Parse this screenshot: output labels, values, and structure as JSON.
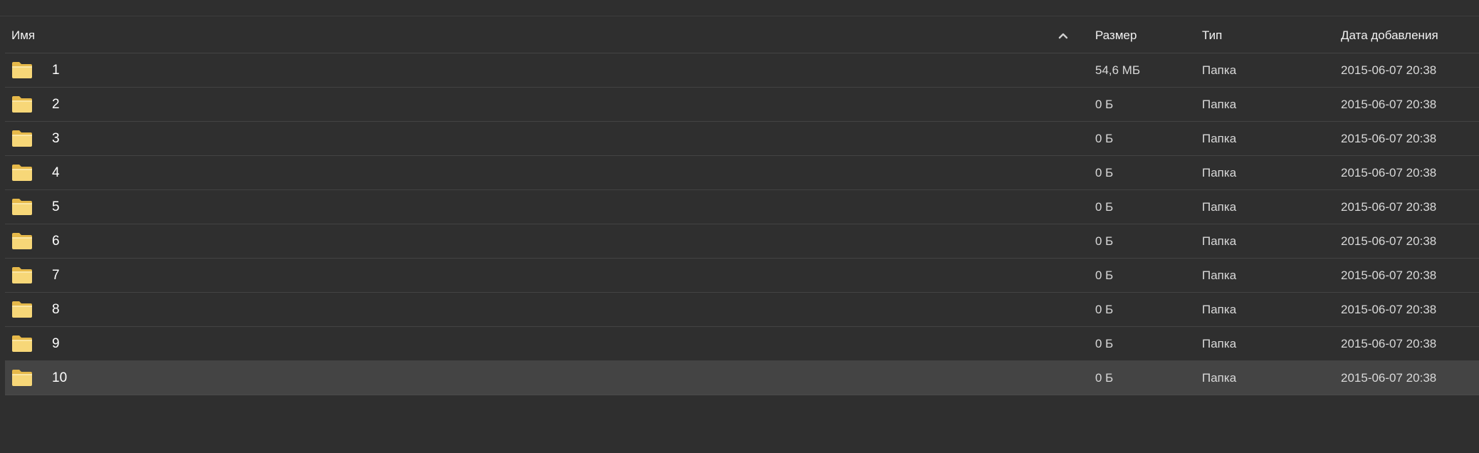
{
  "table": {
    "headers": {
      "name": "Имя",
      "size": "Размер",
      "type": "Тип",
      "date": "Дата добавления"
    },
    "sort": {
      "column": "name",
      "direction": "ascending",
      "icon": "chevron-up-icon"
    },
    "rows": [
      {
        "name": "1",
        "size": "54,6 МБ",
        "type": "Папка",
        "date": "2015-06-07 20:38"
      },
      {
        "name": "2",
        "size": "0 Б",
        "type": "Папка",
        "date": "2015-06-07 20:38"
      },
      {
        "name": "3",
        "size": "0 Б",
        "type": "Папка",
        "date": "2015-06-07 20:38"
      },
      {
        "name": "4",
        "size": "0 Б",
        "type": "Папка",
        "date": "2015-06-07 20:38"
      },
      {
        "name": "5",
        "size": "0 Б",
        "type": "Папка",
        "date": "2015-06-07 20:38"
      },
      {
        "name": "6",
        "size": "0 Б",
        "type": "Папка",
        "date": "2015-06-07 20:38"
      },
      {
        "name": "7",
        "size": "0 Б",
        "type": "Папка",
        "date": "2015-06-07 20:38"
      },
      {
        "name": "8",
        "size": "0 Б",
        "type": "Папка",
        "date": "2015-06-07 20:38"
      },
      {
        "name": "9",
        "size": "0 Б",
        "type": "Папка",
        "date": "2015-06-07 20:38"
      },
      {
        "name": "10",
        "size": "0 Б",
        "type": "Папка",
        "date": "2015-06-07 20:38",
        "selected": true
      }
    ],
    "row_icon": "folder-icon"
  },
  "colors": {
    "background": "#2f2f2f",
    "selected_row": "#444444",
    "folder_fill": "#f7d778",
    "folder_tab": "#e6b94a"
  }
}
